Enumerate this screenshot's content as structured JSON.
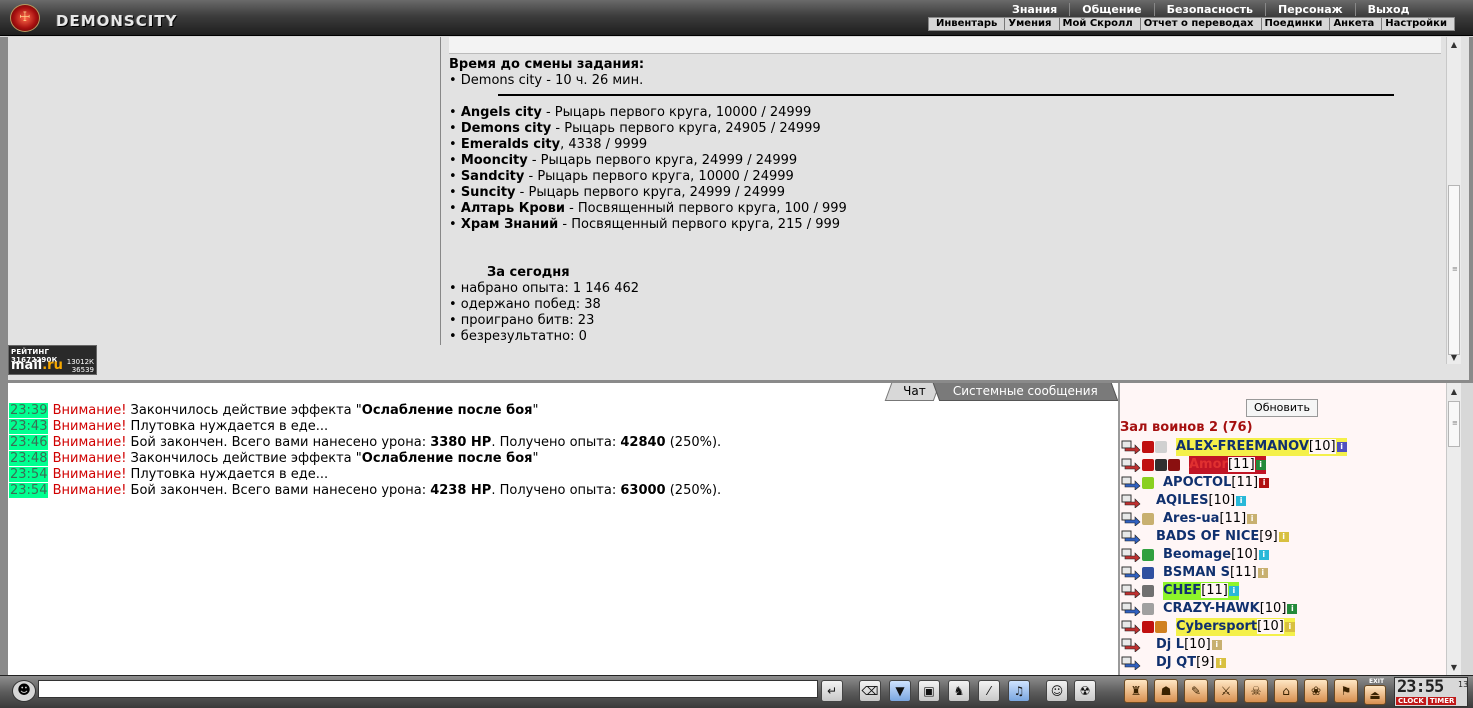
{
  "header": {
    "logo_text": "DEMONSCITY",
    "main_menu": [
      "Знания",
      "Общение",
      "Безопасность",
      "Персонаж",
      "Выход"
    ],
    "sub_menu": [
      "Инвентарь",
      "Умения",
      "Мой Скролл",
      "Отчет о переводах",
      "Поединки",
      "Анкета",
      "Настройки"
    ]
  },
  "quest": {
    "time_title": "Время до смены задания:",
    "time_line": "• Demons city - 10 ч. 26 мин.",
    "cities": [
      {
        "name": "Angels city",
        "rest": " - Рыцарь первого круга, 10000 / 24999"
      },
      {
        "name": "Demons city",
        "rest": " - Рыцарь первого круга, 24905 / 24999"
      },
      {
        "name": "Emeralds city",
        "rest": ", 4338 / 9999"
      },
      {
        "name": "Mooncity",
        "rest": " - Рыцарь первого круга, 24999 / 24999"
      },
      {
        "name": "Sandcity",
        "rest": " - Рыцарь первого круга, 10000 / 24999"
      },
      {
        "name": "Suncity",
        "rest": " - Рыцарь первого круга, 24999 / 24999"
      },
      {
        "name": "Алтарь Крови",
        "rest": " - Посвященный первого круга, 100 / 999"
      },
      {
        "name": "Храм Знаний",
        "rest": " - Посвященный первого круга, 215 / 999"
      }
    ],
    "today_title": "За сегодня",
    "today_stats": [
      "• набрано опыта: 1 146 462",
      "• одержано побед: 38",
      "• проиграно битв: 23",
      "• безрезультатно: 0"
    ]
  },
  "rating_badge": {
    "line1": "РЕЙТИНГ 31672290К",
    "brand_a": "mail",
    "brand_b": ".ru",
    "num1": "13012К",
    "num2": "36539"
  },
  "chat": {
    "tabs": [
      "Чат",
      "Системные сообщения"
    ],
    "messages": [
      {
        "time": "23:39",
        "warn": "Внимание!",
        "text_a": " Закончилось действие эффекта \"",
        "bold": "Ослабление после боя",
        "text_b": "\"",
        "bold2": "",
        "text_c": "",
        "text_d": ""
      },
      {
        "time": "23:43",
        "warn": "Внимание!",
        "text_a": " Плутовка нуждается в еде...",
        "bold": "",
        "text_b": "",
        "bold2": "",
        "text_c": "",
        "text_d": ""
      },
      {
        "time": "23:46",
        "warn": "Внимание!",
        "text_a": " Бой закончен. Всего вами нанесено урона: ",
        "bold": "3380 HP",
        "text_b": ". Получено опыта: ",
        "bold2": "42840",
        "text_c": " (250%).",
        "text_d": ""
      },
      {
        "time": "23:48",
        "warn": "Внимание!",
        "text_a": " Закончилось действие эффекта \"",
        "bold": "Ослабление после боя",
        "text_b": "\"",
        "bold2": "",
        "text_c": "",
        "text_d": ""
      },
      {
        "time": "23:54",
        "warn": "Внимание!",
        "text_a": " Плутовка нуждается в еде...",
        "bold": "",
        "text_b": "",
        "bold2": "",
        "text_c": "",
        "text_d": ""
      },
      {
        "time": "23:54",
        "warn": "Внимание!",
        "text_a": " Бой закончен. Всего вами нанесено урона: ",
        "bold": "4238 HP",
        "text_b": ". Получено опыта: ",
        "bold2": "63000",
        "text_c": " (250%).",
        "text_d": ""
      }
    ],
    "input_value": ""
  },
  "users": {
    "refresh_label": "Обновить",
    "room_title": "Зал воинов 2 (76)",
    "list": [
      {
        "name": "ALEX-FREEMANOV",
        "level": "[10]",
        "style": "hl",
        "info": "i-purple"
      },
      {
        "name": "Amor",
        "level": "[11]",
        "style": "amor",
        "info": "i-green"
      },
      {
        "name": "APOCTOL",
        "level": "[11]",
        "style": "",
        "info": "i-red"
      },
      {
        "name": "AQILES",
        "level": "[10]",
        "style": "",
        "info": "i-cyan"
      },
      {
        "name": "Ares-ua",
        "level": "[11]",
        "style": "",
        "info": "i-tan"
      },
      {
        "name": "BADS OF NICE",
        "level": "[9]",
        "style": "",
        "info": "i-yellow"
      },
      {
        "name": "Beomage",
        "level": "[10]",
        "style": "",
        "info": "i-cyan"
      },
      {
        "name": "BSMAN S",
        "level": "[11]",
        "style": "",
        "info": "i-tan"
      },
      {
        "name": "CHEF",
        "level": "[11]",
        "style": "chef",
        "info": "i-cyan"
      },
      {
        "name": "CRAZY-HAWK",
        "level": "[10]",
        "style": "",
        "info": "i-green"
      },
      {
        "name": "Cybersport",
        "level": "[10]",
        "style": "hl",
        "info": "i-yellow"
      },
      {
        "name": "Dj L",
        "level": "[10]",
        "style": "",
        "info": "i-tan"
      },
      {
        "name": "DJ QT",
        "level": "[9]",
        "style": "",
        "info": "i-yellow"
      }
    ]
  },
  "toolbar": {
    "clock_time": "23:55",
    "clock_sec": "13",
    "clock_tab": "CLOCK",
    "timer_tab": "TIMER",
    "exit_label": "EXIT"
  },
  "colors": {
    "warning": "#d00000",
    "timestamp_bg": "#00ff90",
    "room_title": "#a51010",
    "nick": "#10306e",
    "highlight": "#f4f04a"
  }
}
